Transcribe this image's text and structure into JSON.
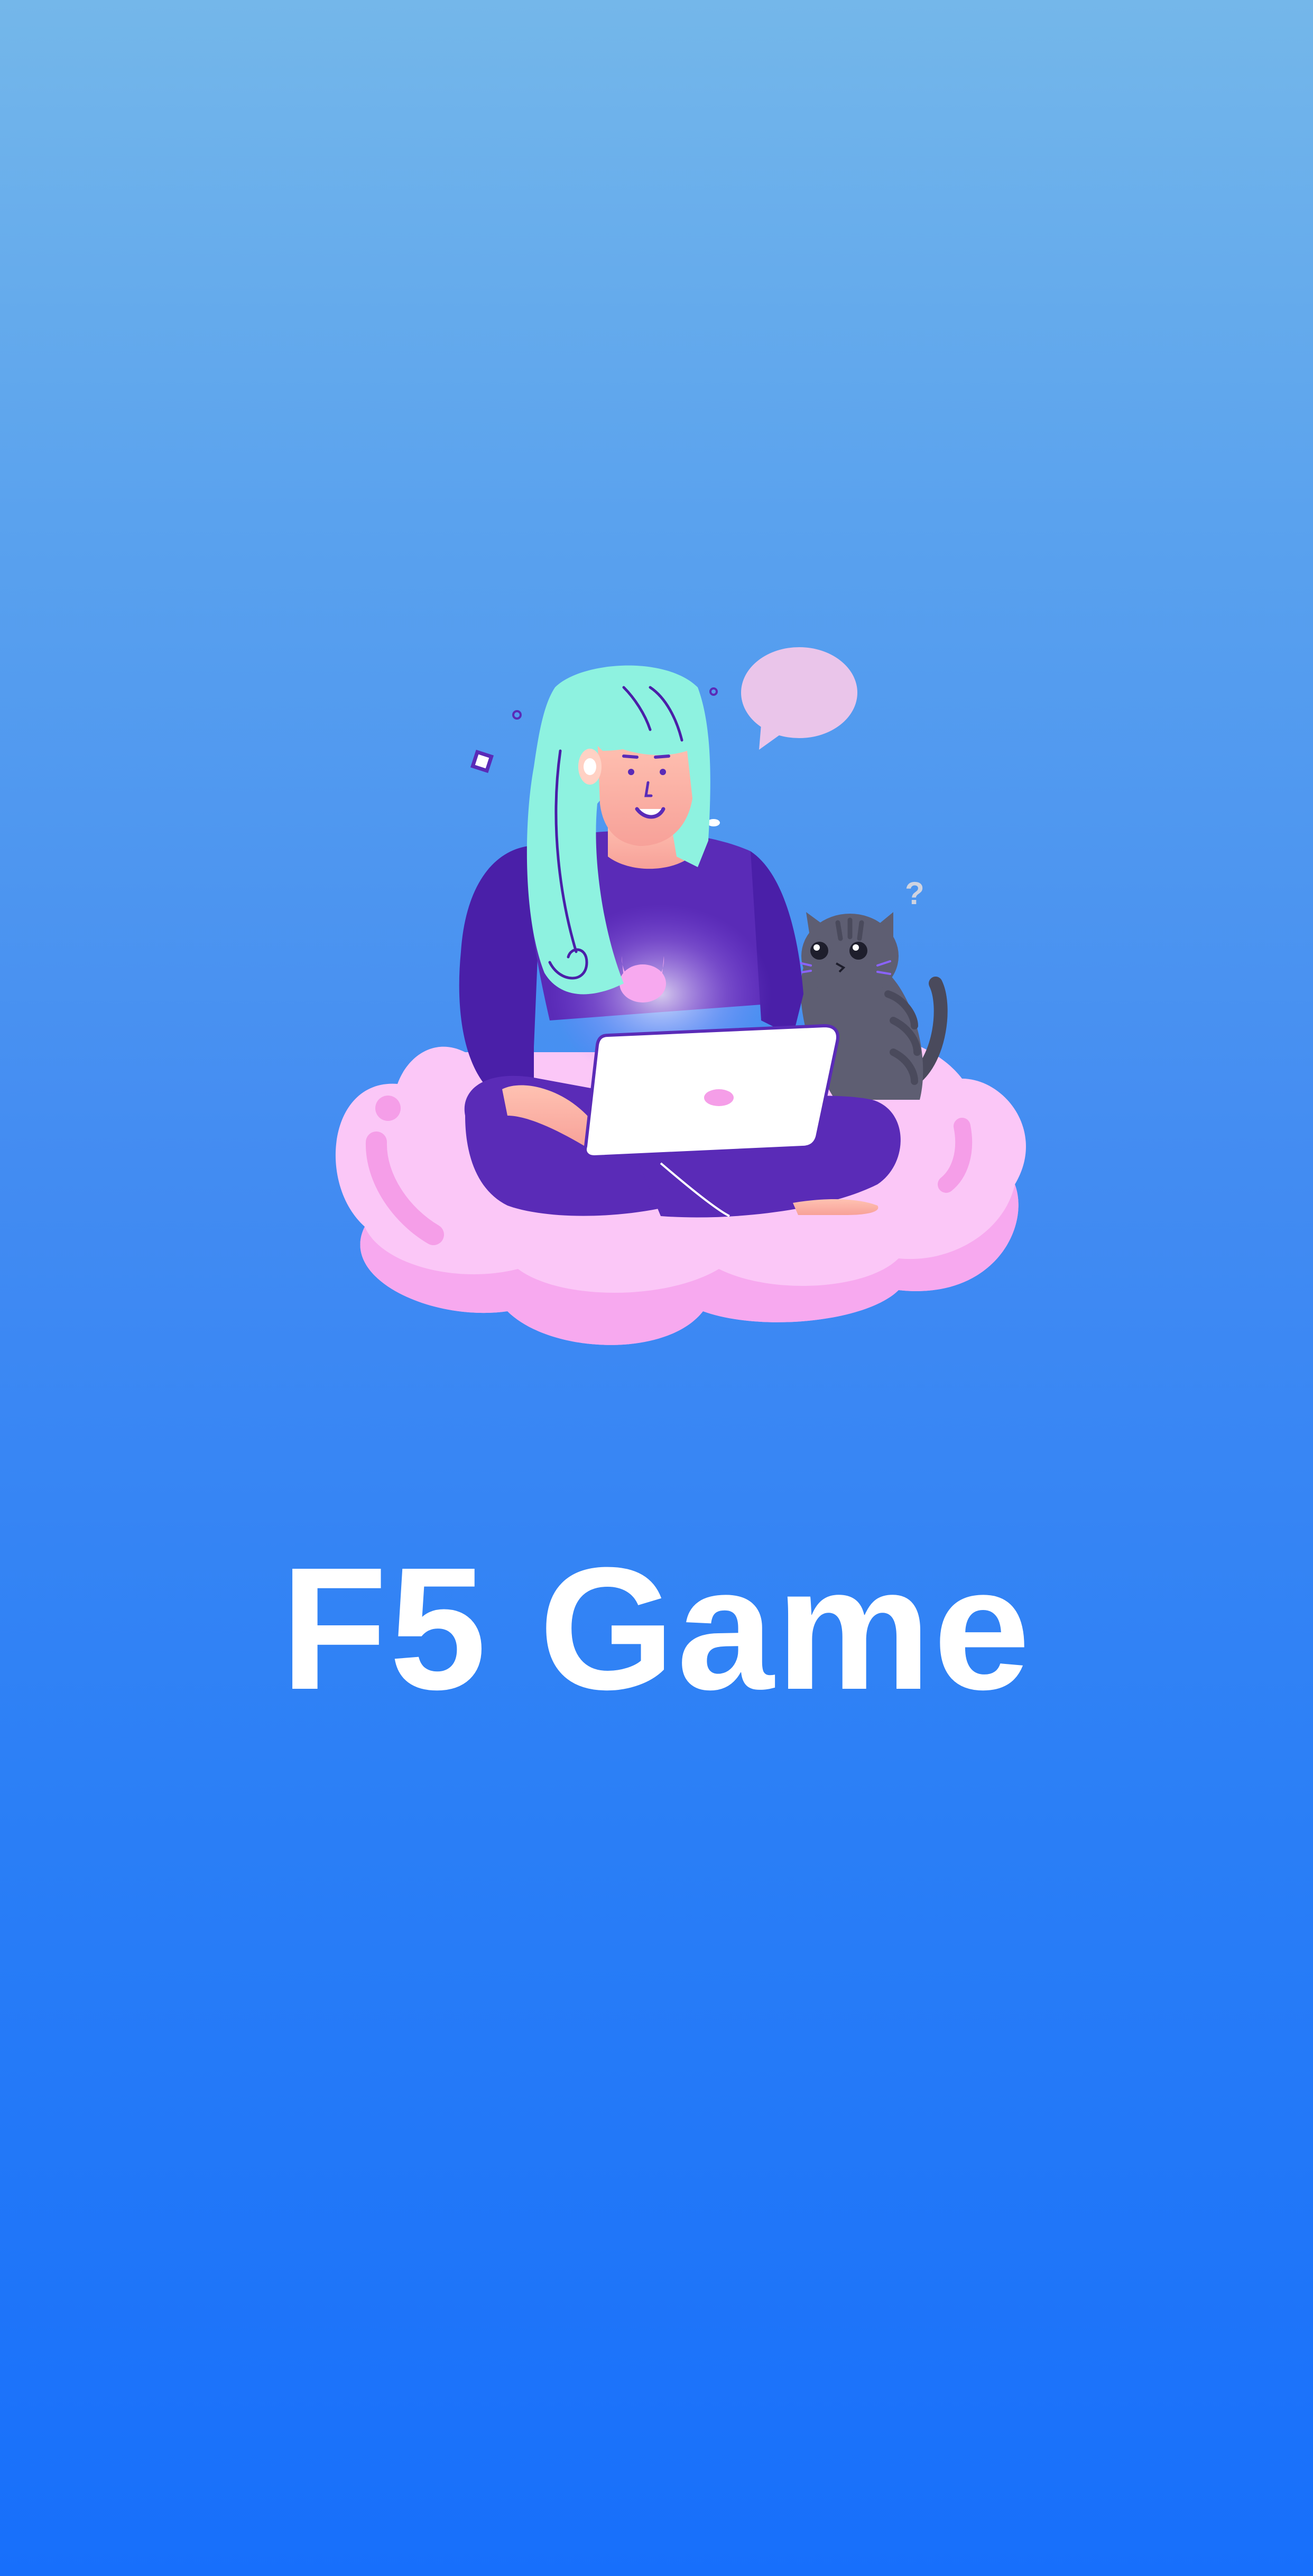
{
  "app": {
    "title": "F5 Game"
  },
  "illustration": {
    "icon": "girl-laptop-cat-on-cloud-illustration",
    "question_mark": "?"
  },
  "colors": {
    "background_top": "#74b7ea",
    "background_bottom": "#176ffb",
    "title_text": "#ffffff",
    "cloud": "#fbc7f7",
    "hair": "#8ef2e0",
    "sweater": "#5a2bb7"
  }
}
